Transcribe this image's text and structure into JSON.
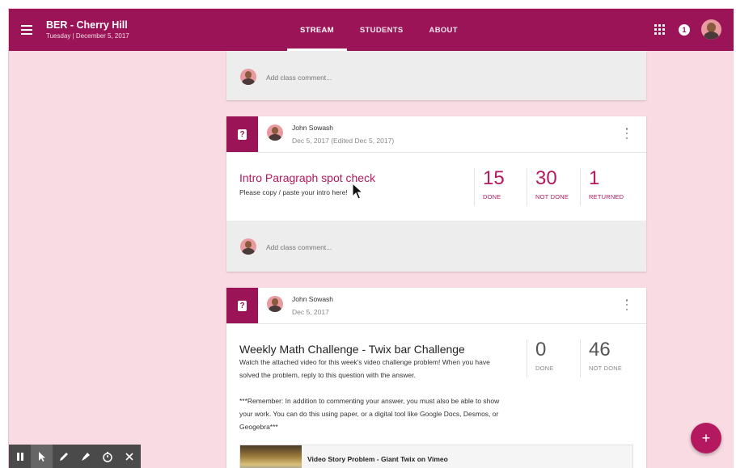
{
  "header": {
    "class_title": "BER - Cherry Hill",
    "class_date": "Tuesday | December 5, 2017",
    "tabs": [
      {
        "label": "STREAM",
        "active": true
      },
      {
        "label": "STUDENTS",
        "active": false
      },
      {
        "label": "ABOUT",
        "active": false
      }
    ],
    "notification_count": "1"
  },
  "stream": {
    "top_comment_placeholder": "Add class comment...",
    "posts": [
      {
        "author": "John Sowash",
        "date": "Dec 5, 2017 (Edited Dec 5, 2017)",
        "title": "Intro Paragraph spot check",
        "description": "Please copy / paste your intro here!",
        "stats": [
          {
            "value": "15",
            "label": "DONE"
          },
          {
            "value": "30",
            "label": "NOT DONE"
          },
          {
            "value": "1",
            "label": "RETURNED"
          }
        ],
        "comment_placeholder": "Add class comment..."
      },
      {
        "author": "John Sowash",
        "date": "Dec 5, 2017",
        "title": "Weekly Math Challenge - Twix bar Challenge",
        "description_lines": [
          "Watch the attached video for this week's video challenge problem! When you have",
          "solved the problem, reply to this question with the answer.",
          "",
          "***Remember: In addition to commenting your answer, you must also be able to show",
          "your work. You can do this using paper, or a digital tool like Google Docs, Desmos, or",
          "Geogebra***"
        ],
        "stats": [
          {
            "value": "0",
            "label": "DONE"
          },
          {
            "value": "46",
            "label": "NOT DONE"
          }
        ],
        "attachment_title": "Video Story Problem - Giant Twix on Vimeo"
      }
    ]
  },
  "fab_label": "+",
  "recorder": {
    "buttons": [
      "pause-icon",
      "pointer-icon",
      "pen-icon",
      "highlighter-icon",
      "timer-icon",
      "close-icon"
    ]
  },
  "colors": {
    "brand": "#9b1457",
    "accent": "#b4185f",
    "background": "#f8dbe3"
  }
}
